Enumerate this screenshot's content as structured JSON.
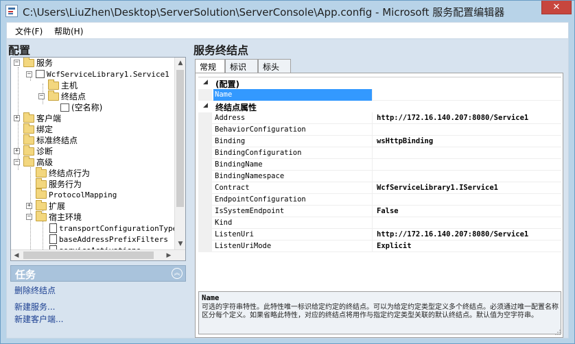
{
  "window": {
    "title": "C:\\Users\\LiuZhen\\Desktop\\ServerSolution\\ServerConsole\\App.config - Microsoft 服务配置编辑器",
    "close_glyph": "✕"
  },
  "menu": {
    "file": "文件(F)",
    "help": "帮助(H)"
  },
  "left_pane": {
    "title": "配置",
    "tree": [
      {
        "label": "服务",
        "expander": "−"
      },
      {
        "label": "WcfServiceLibrary1.Service1",
        "expander": "−"
      },
      {
        "label": "主机"
      },
      {
        "label": "终结点",
        "expander": "−"
      },
      {
        "label": "(空名称)"
      },
      {
        "label": "客户端",
        "expander": "+"
      },
      {
        "label": "绑定"
      },
      {
        "label": "标准终结点"
      },
      {
        "label": "诊断",
        "expander": "+"
      },
      {
        "label": "高级",
        "expander": "−"
      },
      {
        "label": "终结点行为"
      },
      {
        "label": "服务行为"
      },
      {
        "label": "ProtocolMapping"
      },
      {
        "label": "扩展",
        "expander": "+"
      },
      {
        "label": "宿主环境",
        "expander": "−"
      },
      {
        "label": "transportConfigurationType"
      },
      {
        "label": "baseAddressPrefixFilters"
      },
      {
        "label": "serviceActivations"
      }
    ],
    "scroll": {
      "up": "▲",
      "down": "▼",
      "left": "◀",
      "right": "▶"
    }
  },
  "tasks": {
    "title": "任务",
    "collapse_glyph": "︽",
    "links": [
      "删除终结点",
      "新建服务...",
      "新建客户端..."
    ]
  },
  "right_pane": {
    "title": "服务终结点",
    "tabs": [
      "常规",
      "标识",
      "标头"
    ],
    "categories": [
      {
        "label": "(配置)",
        "toggle": "◢"
      },
      {
        "label": "终结点属性",
        "toggle": "◢"
      }
    ],
    "properties": [
      {
        "name": "Name",
        "value": ""
      },
      {
        "name": "Address",
        "value": "http://172.16.140.207:8080/Service1"
      },
      {
        "name": "BehaviorConfiguration",
        "value": ""
      },
      {
        "name": "Binding",
        "value": "wsHttpBinding"
      },
      {
        "name": "BindingConfiguration",
        "value": ""
      },
      {
        "name": "BindingName",
        "value": ""
      },
      {
        "name": "BindingNamespace",
        "value": ""
      },
      {
        "name": "Contract",
        "value": "WcfServiceLibrary1.IService1"
      },
      {
        "name": "EndpointConfiguration",
        "value": ""
      },
      {
        "name": "IsSystemEndpoint",
        "value": "False"
      },
      {
        "name": "Kind",
        "value": ""
      },
      {
        "name": "ListenUri",
        "value": "http://172.16.140.207:8080/Service1"
      },
      {
        "name": "ListenUriMode",
        "value": "Explicit"
      }
    ],
    "description": {
      "title": "Name",
      "text": "可选的字符串特性。此特性唯一标识给定约定的终结点。可以为给定约定类型定义多个终结点。必须通过唯一配置名称区分每个定义。如果省略此特性，对应的终结点将用作与指定约定类型关联的默认终结点。默认值为空字符串。"
    }
  },
  "colors": {
    "selection": "#3399ff",
    "link": "#1b3f91",
    "close_button": "#c7463e"
  }
}
